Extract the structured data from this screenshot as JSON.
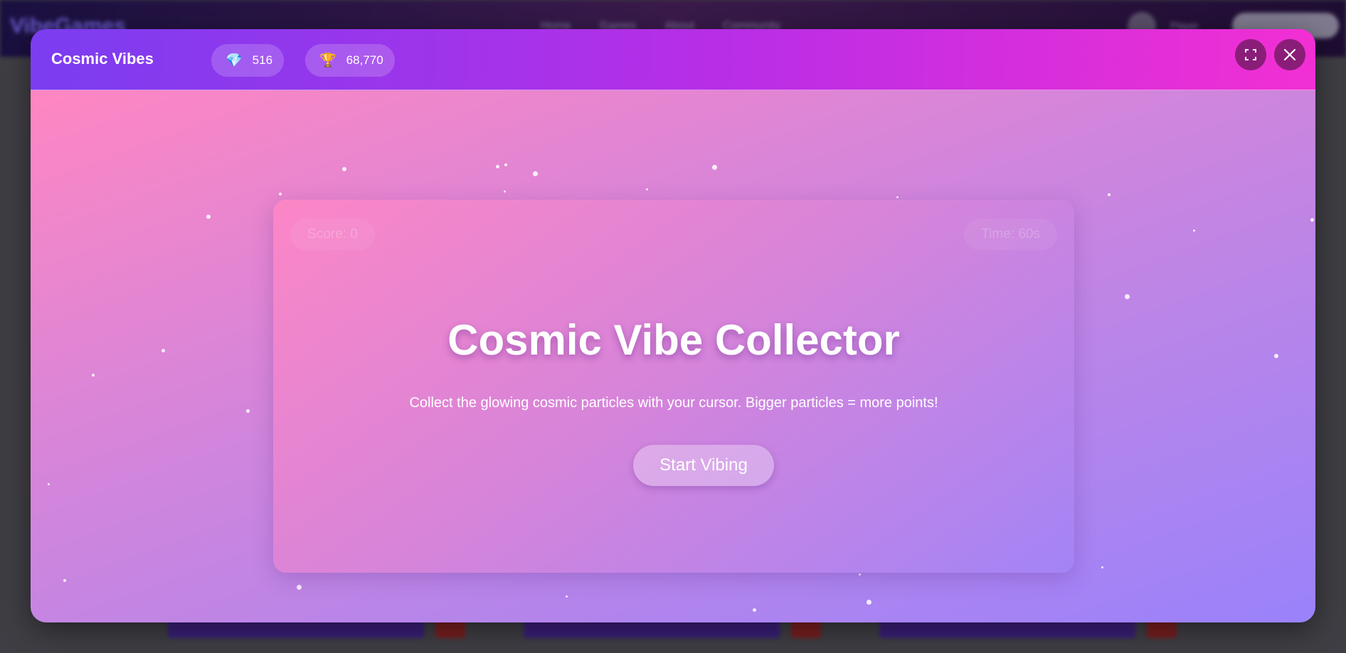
{
  "background_page": {
    "logo": "VibeGames",
    "nav_links": [
      "Home",
      "Games",
      "About",
      "Community"
    ],
    "user": "Player"
  },
  "modal": {
    "title": "Cosmic Vibes",
    "gems": {
      "icon": "gem-icon",
      "value": "516"
    },
    "trophies": {
      "icon": "trophy-icon",
      "value": "68,770"
    },
    "fullscreen_icon": "fullscreen-icon",
    "close_icon": "close-icon"
  },
  "game": {
    "score_label": "Score: 0",
    "time_label": "Time: 60s",
    "heading": "Cosmic Vibe Collector",
    "description": "Collect the glowing cosmic particles with your cursor. Bigger particles = more points!",
    "start_button": "Start Vibing"
  },
  "colors": {
    "header_start": "#7b3df0",
    "header_end": "#f22fd3",
    "body_start": "#ff86c2",
    "body_end": "#9a82fb"
  }
}
